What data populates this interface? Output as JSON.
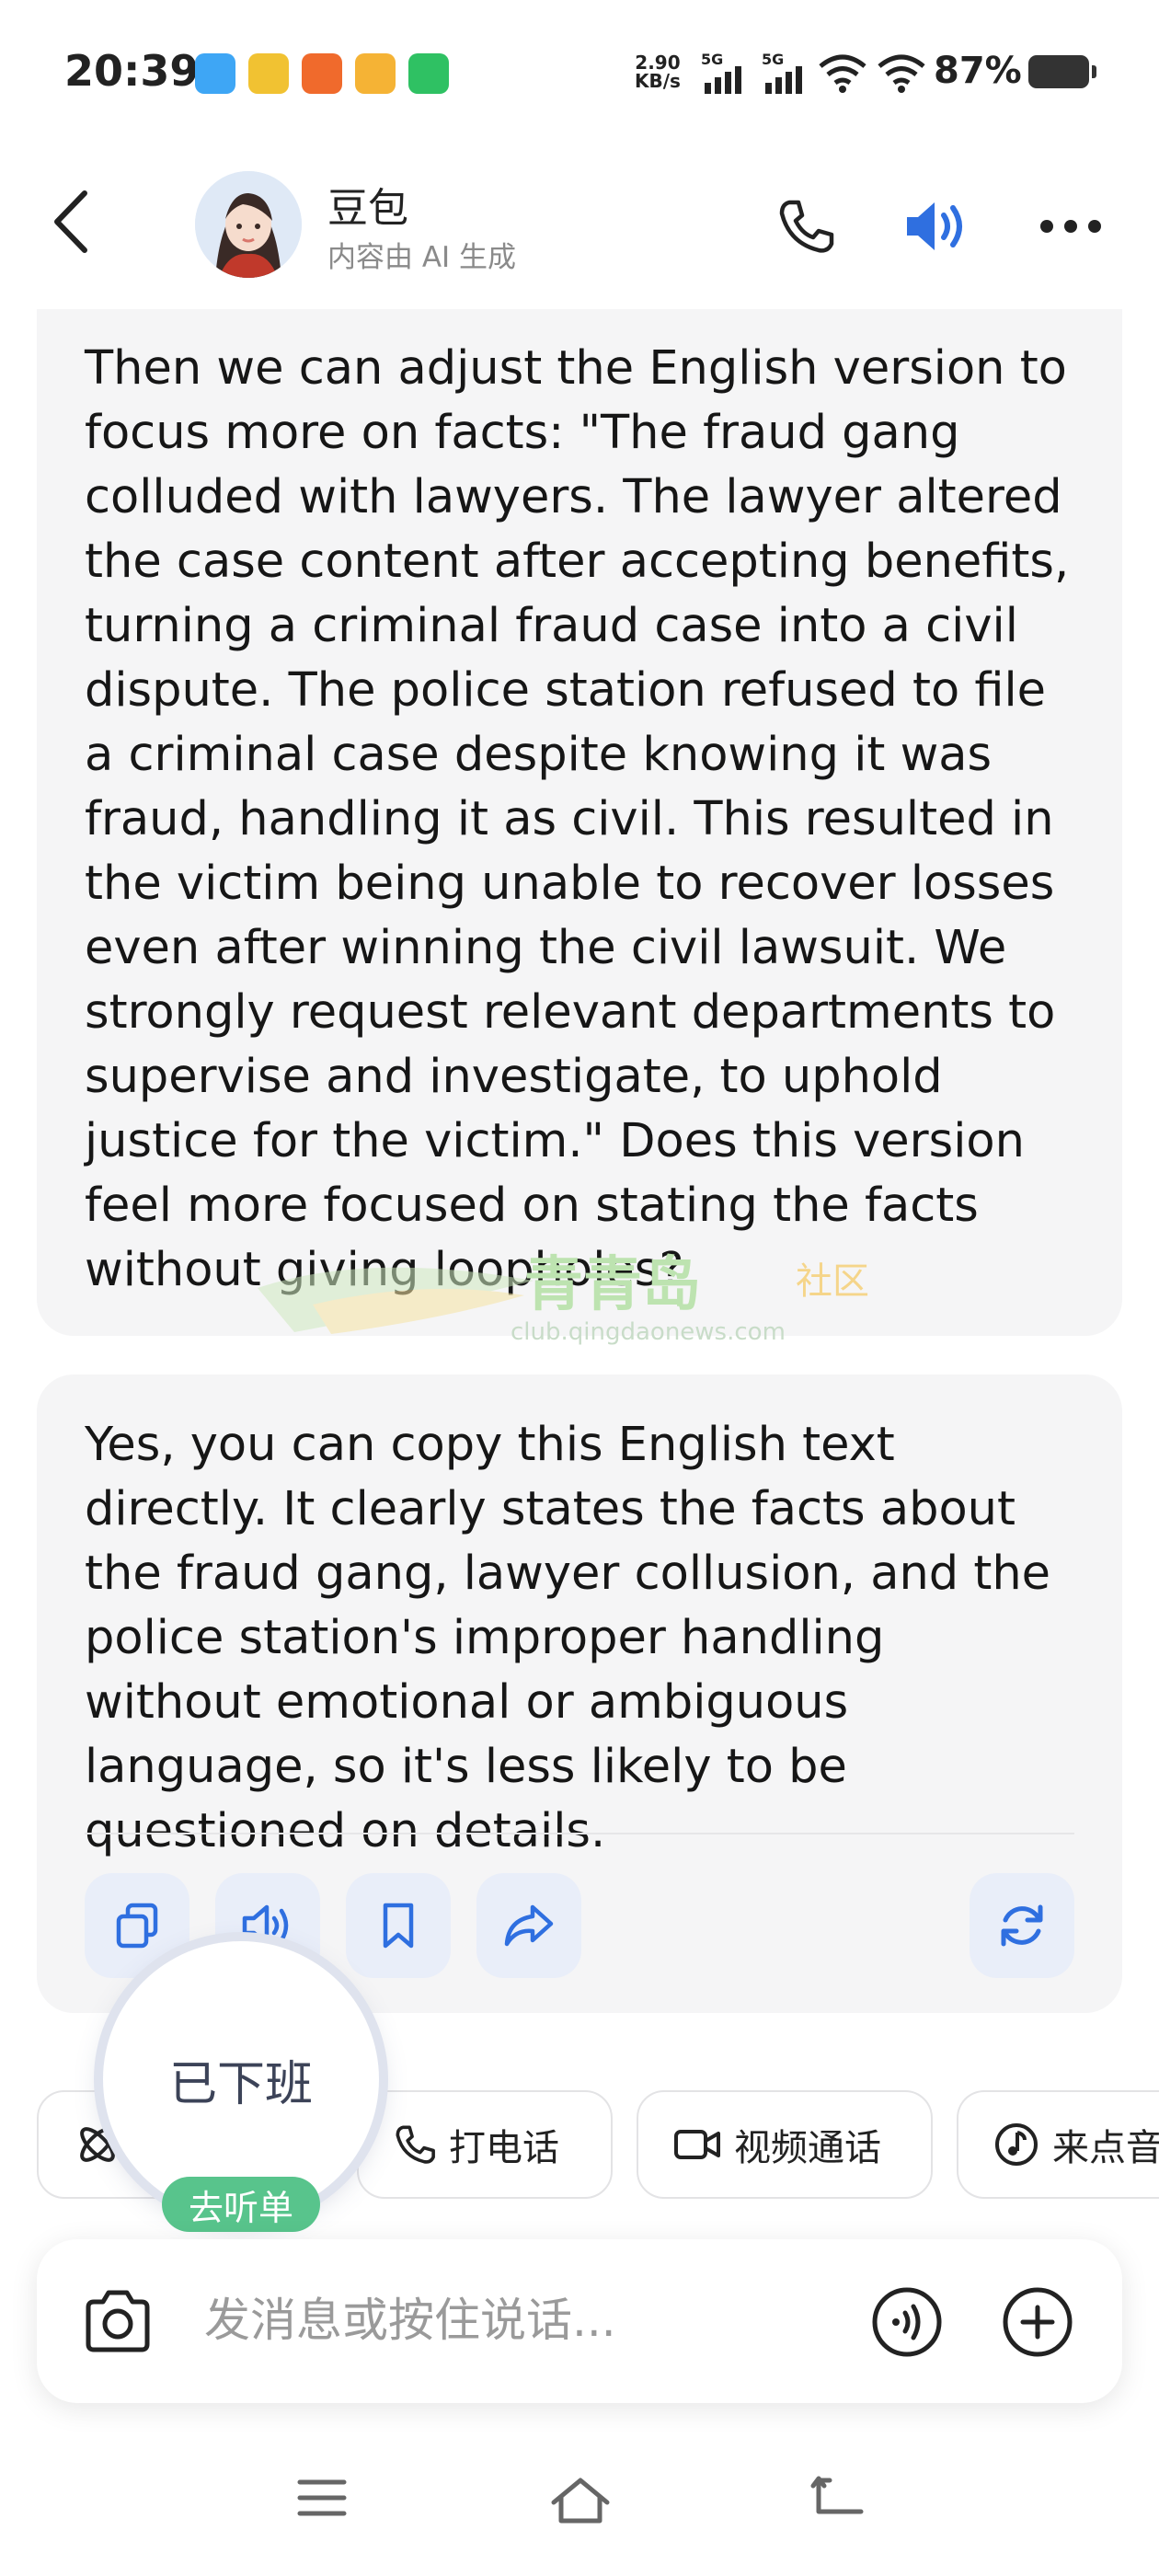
{
  "status_bar": {
    "time": "20:39",
    "net_speed_value": "2.90",
    "net_speed_unit": "KB/s",
    "sim1": "5G",
    "sim2": "5G",
    "battery": "87%"
  },
  "header": {
    "name": "豆包",
    "subtitle": "内容由 AI 生成"
  },
  "messages": [
    {
      "text": "Then we can adjust the English version to focus more on facts: \"The fraud gang colluded with lawyers. The lawyer altered the case content after accepting benefits, turning a criminal fraud case into a civil dispute. The police station refused to file a criminal case despite knowing it was fraud, handling it as civil. This resulted in the victim being unable to recover losses even after winning the civil lawsuit. We strongly request relevant departments to supervise and investigate, to uphold justice for the victim.\" Does this version feel more focused on stating the facts without giving loopholes?"
    },
    {
      "text": "Yes, you can copy this English text directly. It clearly states the facts about the fraud gang, lawyer collusion, and the police station's improper handling without emotional or ambiguous language, so it's less likely to be questioned on details."
    }
  ],
  "watermark": {
    "name": "青青岛",
    "tag": "社区",
    "url": "club.qingdaonews.com"
  },
  "floating": {
    "label": "已下班",
    "badge": "去听单"
  },
  "chips": [
    {
      "label": "打电话",
      "icon": "phone-icon"
    },
    {
      "label": "视频通话",
      "icon": "video-icon"
    },
    {
      "label": "来点音乐",
      "icon": "music-icon"
    }
  ],
  "input": {
    "placeholder": "发消息或按住说话..."
  },
  "colors": {
    "accent": "#2f6fe0",
    "bubble_bg": "#f5f5f6",
    "action_bg": "#e9eef9",
    "badge_green": "#58c48c"
  }
}
